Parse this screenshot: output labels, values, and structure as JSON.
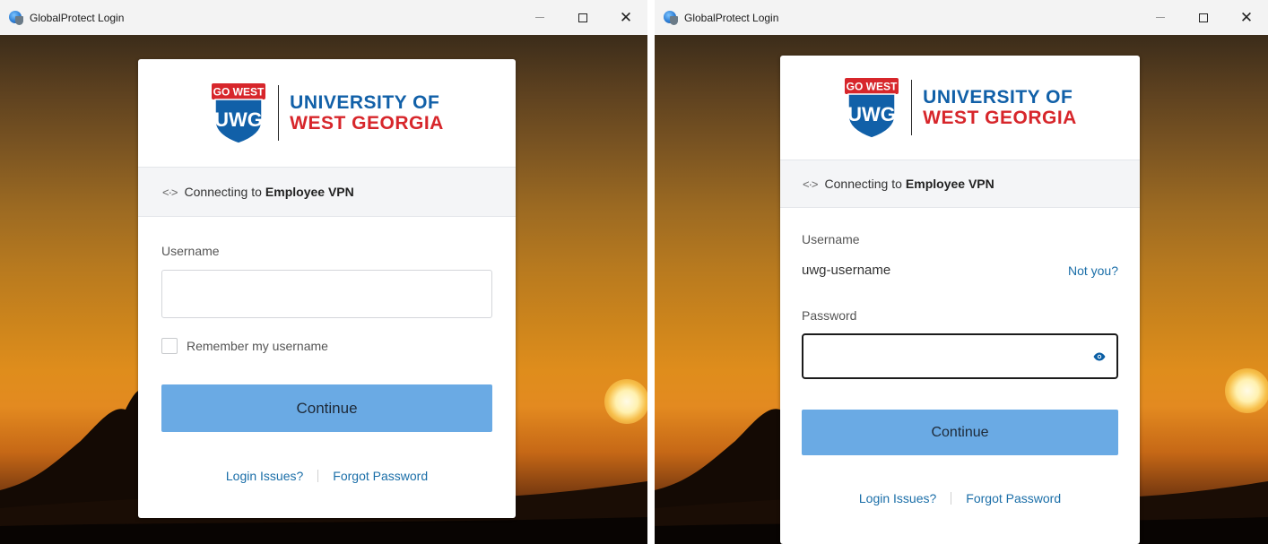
{
  "windows": [
    {
      "title": "GlobalProtect Login",
      "logo": {
        "badge": "GO WEST",
        "monogram": "UWG",
        "line1": "UNIVERSITY OF",
        "line2": "WEST GEORGIA"
      },
      "connecting": {
        "prefix": "Connecting to",
        "network": "Employee VPN"
      },
      "username_label": "Username",
      "username_value": "",
      "remember_label": "Remember my username",
      "continue_label": "Continue",
      "links": {
        "login_issues": "Login Issues?",
        "forgot_password": "Forgot Password"
      }
    },
    {
      "title": "GlobalProtect Login",
      "logo": {
        "badge": "GO WEST",
        "monogram": "UWG",
        "line1": "UNIVERSITY OF",
        "line2": "WEST GEORGIA"
      },
      "connecting": {
        "prefix": "Connecting to",
        "network": "Employee VPN"
      },
      "username_label": "Username",
      "username_value": "uwg-username",
      "not_you": "Not you?",
      "password_label": "Password",
      "password_value": "",
      "continue_label": "Continue",
      "links": {
        "login_issues": "Login Issues?",
        "forgot_password": "Forgot Password"
      }
    }
  ],
  "colors": {
    "brand_blue": "#1160a8",
    "brand_red": "#d7262b",
    "button": "#6aaae4",
    "link": "#1a6ea8"
  },
  "icons": [
    "globalprotect-app-icon",
    "minimize-icon",
    "maximize-icon",
    "close-icon",
    "connect-arrows-icon",
    "eye-icon",
    "uwg-shield-logo"
  ]
}
